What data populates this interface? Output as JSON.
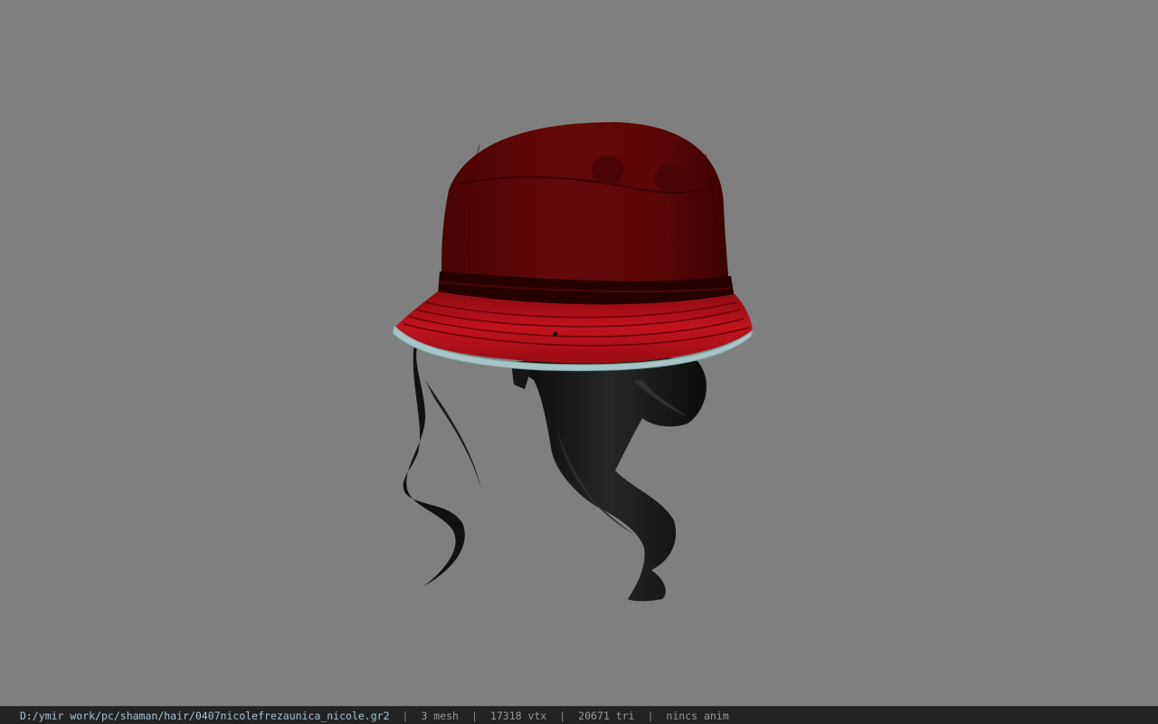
{
  "status_bar": {
    "file_path": "D:/ymir work/pc/shaman/hair/0407nicolefrezaunica_nicole.gr2",
    "separator": "|",
    "mesh_count": "3 mesh",
    "vertex_count": "17318 vtx",
    "triangle_count": "20671 tri",
    "animation": "nincs anim"
  },
  "colors": {
    "background": "#7f7f7f",
    "hat_crown": "#5a0606",
    "hat_brim": "#b3121a",
    "hat_band": "#2a0000",
    "brim_edge": "#a9c4c4",
    "hair": "#121212"
  }
}
